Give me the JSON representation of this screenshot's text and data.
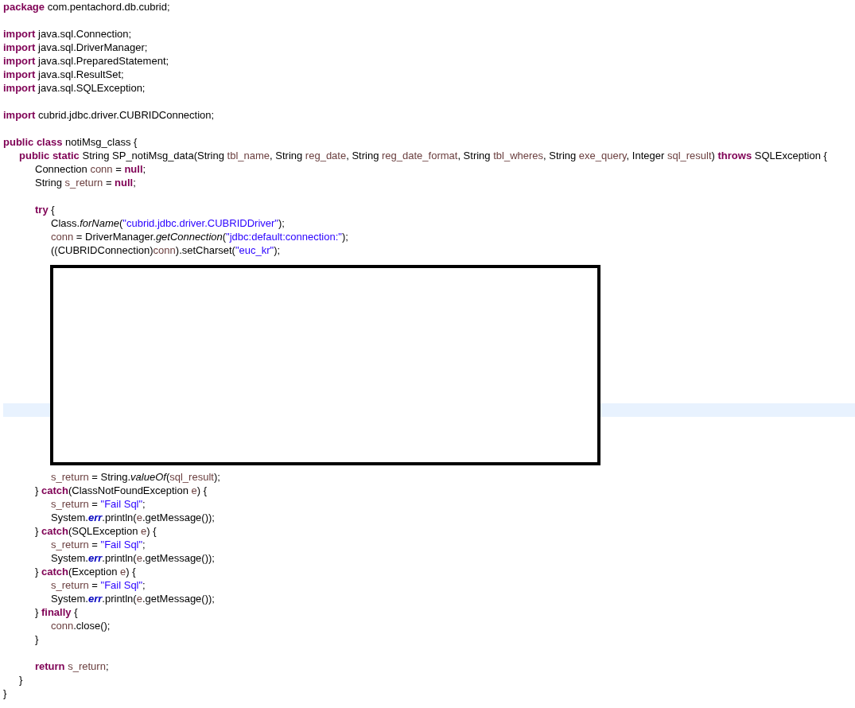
{
  "editor": {
    "lines": [
      {
        "kind": "code",
        "tokens": [
          {
            "kind": "keyword",
            "text": "package"
          },
          {
            "kind": "plain",
            "text": " com.pentachord.db.cubrid;"
          }
        ]
      },
      {
        "kind": "blank"
      },
      {
        "kind": "code",
        "tokens": [
          {
            "kind": "keyword",
            "text": "import"
          },
          {
            "kind": "plain",
            "text": " java.sql.Connection;"
          }
        ]
      },
      {
        "kind": "code",
        "tokens": [
          {
            "kind": "keyword",
            "text": "import"
          },
          {
            "kind": "plain",
            "text": " java.sql.DriverManager;"
          }
        ]
      },
      {
        "kind": "code",
        "tokens": [
          {
            "kind": "keyword",
            "text": "import"
          },
          {
            "kind": "plain",
            "text": " java.sql.PreparedStatement;"
          }
        ]
      },
      {
        "kind": "code",
        "tokens": [
          {
            "kind": "keyword",
            "text": "import"
          },
          {
            "kind": "plain",
            "text": " java.sql.ResultSet;"
          }
        ]
      },
      {
        "kind": "code",
        "tokens": [
          {
            "kind": "keyword",
            "text": "import"
          },
          {
            "kind": "plain",
            "text": " java.sql.SQLException;"
          }
        ]
      },
      {
        "kind": "blank"
      },
      {
        "kind": "code",
        "tokens": [
          {
            "kind": "keyword",
            "text": "import"
          },
          {
            "kind": "plain",
            "text": " cubrid.jdbc.driver.CUBRIDConnection;"
          }
        ]
      },
      {
        "kind": "blank"
      },
      {
        "kind": "code",
        "tokens": [
          {
            "kind": "keyword",
            "text": "public class"
          },
          {
            "kind": "plain",
            "text": " notiMsg_class {"
          }
        ],
        "children": [
          {
            "kind": "code",
            "tokens": [
              {
                "kind": "keyword",
                "text": "public static"
              },
              {
                "kind": "plain",
                "text": " String SP_notiMsg_data(String "
              },
              {
                "kind": "variable",
                "text": "tbl_name"
              },
              {
                "kind": "plain",
                "text": ", String "
              },
              {
                "kind": "variable",
                "text": "reg_date"
              },
              {
                "kind": "plain",
                "text": ", String "
              },
              {
                "kind": "variable",
                "text": "reg_date_format"
              },
              {
                "kind": "plain",
                "text": ", String "
              },
              {
                "kind": "variable",
                "text": "tbl_wheres"
              },
              {
                "kind": "plain",
                "text": ", String "
              },
              {
                "kind": "variable",
                "text": "exe_query"
              },
              {
                "kind": "plain",
                "text": ", Integer "
              },
              {
                "kind": "variable",
                "text": "sql_result"
              },
              {
                "kind": "plain",
                "text": ") "
              },
              {
                "kind": "keyword",
                "text": "throws"
              },
              {
                "kind": "plain",
                "text": " SQLException {"
              }
            ],
            "children": [
              {
                "kind": "code",
                "tokens": [
                  {
                    "kind": "plain",
                    "text": "Connection "
                  },
                  {
                    "kind": "variable",
                    "text": "conn"
                  },
                  {
                    "kind": "plain",
                    "text": " = "
                  },
                  {
                    "kind": "keyword",
                    "text": "null"
                  },
                  {
                    "kind": "plain",
                    "text": ";"
                  }
                ]
              },
              {
                "kind": "code",
                "tokens": [
                  {
                    "kind": "plain",
                    "text": "String "
                  },
                  {
                    "kind": "variable",
                    "text": "s_return"
                  },
                  {
                    "kind": "plain",
                    "text": " = "
                  },
                  {
                    "kind": "keyword",
                    "text": "null"
                  },
                  {
                    "kind": "plain",
                    "text": ";"
                  }
                ]
              },
              {
                "kind": "blank"
              },
              {
                "kind": "code",
                "tokens": [
                  {
                    "kind": "keyword",
                    "text": "try"
                  },
                  {
                    "kind": "plain",
                    "text": " {"
                  }
                ],
                "children": [
                  {
                    "kind": "code",
                    "tokens": [
                      {
                        "kind": "plain",
                        "text": "Class."
                      },
                      {
                        "kind": "static_method",
                        "text": "forName"
                      },
                      {
                        "kind": "plain",
                        "text": "("
                      },
                      {
                        "kind": "string",
                        "text": "\"cubrid.jdbc.driver.CUBRIDDriver\""
                      },
                      {
                        "kind": "plain",
                        "text": ");"
                      }
                    ]
                  },
                  {
                    "kind": "code",
                    "tokens": [
                      {
                        "kind": "variable",
                        "text": "conn"
                      },
                      {
                        "kind": "plain",
                        "text": " = DriverManager."
                      },
                      {
                        "kind": "static_method",
                        "text": "getConnection"
                      },
                      {
                        "kind": "plain",
                        "text": "("
                      },
                      {
                        "kind": "string",
                        "text": "\"jdbc:default:connection:\""
                      },
                      {
                        "kind": "plain",
                        "text": ");"
                      }
                    ]
                  },
                  {
                    "kind": "code",
                    "tokens": [
                      {
                        "kind": "plain",
                        "text": "((CUBRIDConnection)"
                      },
                      {
                        "kind": "variable",
                        "text": "conn"
                      },
                      {
                        "kind": "plain",
                        "text": ").setCharset("
                      },
                      {
                        "kind": "string",
                        "text": "\"euc_kr\""
                      },
                      {
                        "kind": "plain",
                        "text": ");"
                      }
                    ]
                  },
                  {
                    "kind": "redacted",
                    "current_line_highlight": true
                  },
                  {
                    "kind": "code",
                    "tokens": [
                      {
                        "kind": "variable",
                        "text": "s_return"
                      },
                      {
                        "kind": "plain",
                        "text": " = String."
                      },
                      {
                        "kind": "static_method",
                        "text": "valueOf"
                      },
                      {
                        "kind": "plain",
                        "text": "("
                      },
                      {
                        "kind": "variable",
                        "text": "sql_result"
                      },
                      {
                        "kind": "plain",
                        "text": ");"
                      }
                    ]
                  }
                ]
              },
              {
                "kind": "code",
                "tokens": [
                  {
                    "kind": "plain",
                    "text": "} "
                  },
                  {
                    "kind": "keyword",
                    "text": "catch"
                  },
                  {
                    "kind": "plain",
                    "text": "(ClassNotFoundException "
                  },
                  {
                    "kind": "variable",
                    "text": "e"
                  },
                  {
                    "kind": "plain",
                    "text": ") {"
                  }
                ],
                "children": [
                  {
                    "kind": "code",
                    "tokens": [
                      {
                        "kind": "variable",
                        "text": "s_return"
                      },
                      {
                        "kind": "plain",
                        "text": " = "
                      },
                      {
                        "kind": "string",
                        "text": "\"Fail Sql\""
                      },
                      {
                        "kind": "plain",
                        "text": ";"
                      }
                    ]
                  },
                  {
                    "kind": "code",
                    "tokens": [
                      {
                        "kind": "plain",
                        "text": "System."
                      },
                      {
                        "kind": "static_field",
                        "text": "err"
                      },
                      {
                        "kind": "plain",
                        "text": ".println("
                      },
                      {
                        "kind": "variable",
                        "text": "e"
                      },
                      {
                        "kind": "plain",
                        "text": ".getMessage());"
                      }
                    ]
                  }
                ]
              },
              {
                "kind": "code",
                "tokens": [
                  {
                    "kind": "plain",
                    "text": "} "
                  },
                  {
                    "kind": "keyword",
                    "text": "catch"
                  },
                  {
                    "kind": "plain",
                    "text": "(SQLException "
                  },
                  {
                    "kind": "variable",
                    "text": "e"
                  },
                  {
                    "kind": "plain",
                    "text": ") {"
                  }
                ],
                "children": [
                  {
                    "kind": "code",
                    "tokens": [
                      {
                        "kind": "variable",
                        "text": "s_return"
                      },
                      {
                        "kind": "plain",
                        "text": " = "
                      },
                      {
                        "kind": "string",
                        "text": "\"Fail Sql\""
                      },
                      {
                        "kind": "plain",
                        "text": ";"
                      }
                    ]
                  },
                  {
                    "kind": "code",
                    "tokens": [
                      {
                        "kind": "plain",
                        "text": "System."
                      },
                      {
                        "kind": "static_field",
                        "text": "err"
                      },
                      {
                        "kind": "plain",
                        "text": ".println("
                      },
                      {
                        "kind": "variable",
                        "text": "e"
                      },
                      {
                        "kind": "plain",
                        "text": ".getMessage());"
                      }
                    ]
                  }
                ]
              },
              {
                "kind": "code",
                "tokens": [
                  {
                    "kind": "plain",
                    "text": "} "
                  },
                  {
                    "kind": "keyword",
                    "text": "catch"
                  },
                  {
                    "kind": "plain",
                    "text": "(Exception "
                  },
                  {
                    "kind": "variable",
                    "text": "e"
                  },
                  {
                    "kind": "plain",
                    "text": ") {"
                  }
                ],
                "children": [
                  {
                    "kind": "code",
                    "tokens": [
                      {
                        "kind": "variable",
                        "text": "s_return"
                      },
                      {
                        "kind": "plain",
                        "text": " = "
                      },
                      {
                        "kind": "string",
                        "text": "\"Fail Sql\""
                      },
                      {
                        "kind": "plain",
                        "text": ";"
                      }
                    ]
                  },
                  {
                    "kind": "code",
                    "tokens": [
                      {
                        "kind": "plain",
                        "text": "System."
                      },
                      {
                        "kind": "static_field",
                        "text": "err"
                      },
                      {
                        "kind": "plain",
                        "text": ".println("
                      },
                      {
                        "kind": "variable",
                        "text": "e"
                      },
                      {
                        "kind": "plain",
                        "text": ".getMessage());"
                      }
                    ]
                  }
                ]
              },
              {
                "kind": "code",
                "tokens": [
                  {
                    "kind": "plain",
                    "text": "} "
                  },
                  {
                    "kind": "keyword",
                    "text": "finally"
                  },
                  {
                    "kind": "plain",
                    "text": " {"
                  }
                ],
                "children": [
                  {
                    "kind": "code",
                    "tokens": [
                      {
                        "kind": "variable",
                        "text": "conn"
                      },
                      {
                        "kind": "plain",
                        "text": ".close();"
                      }
                    ]
                  }
                ]
              },
              {
                "kind": "code",
                "tokens": [
                  {
                    "kind": "plain",
                    "text": "}"
                  }
                ]
              },
              {
                "kind": "blank"
              },
              {
                "kind": "code",
                "tokens": [
                  {
                    "kind": "keyword",
                    "text": "return"
                  },
                  {
                    "kind": "variable",
                    "text": " s_return"
                  },
                  {
                    "kind": "plain",
                    "text": ";"
                  }
                ]
              }
            ]
          },
          {
            "kind": "code",
            "tokens": [
              {
                "kind": "plain",
                "text": "}"
              }
            ]
          }
        ]
      },
      {
        "kind": "code",
        "tokens": [
          {
            "kind": "plain",
            "text": "}"
          }
        ]
      }
    ]
  }
}
